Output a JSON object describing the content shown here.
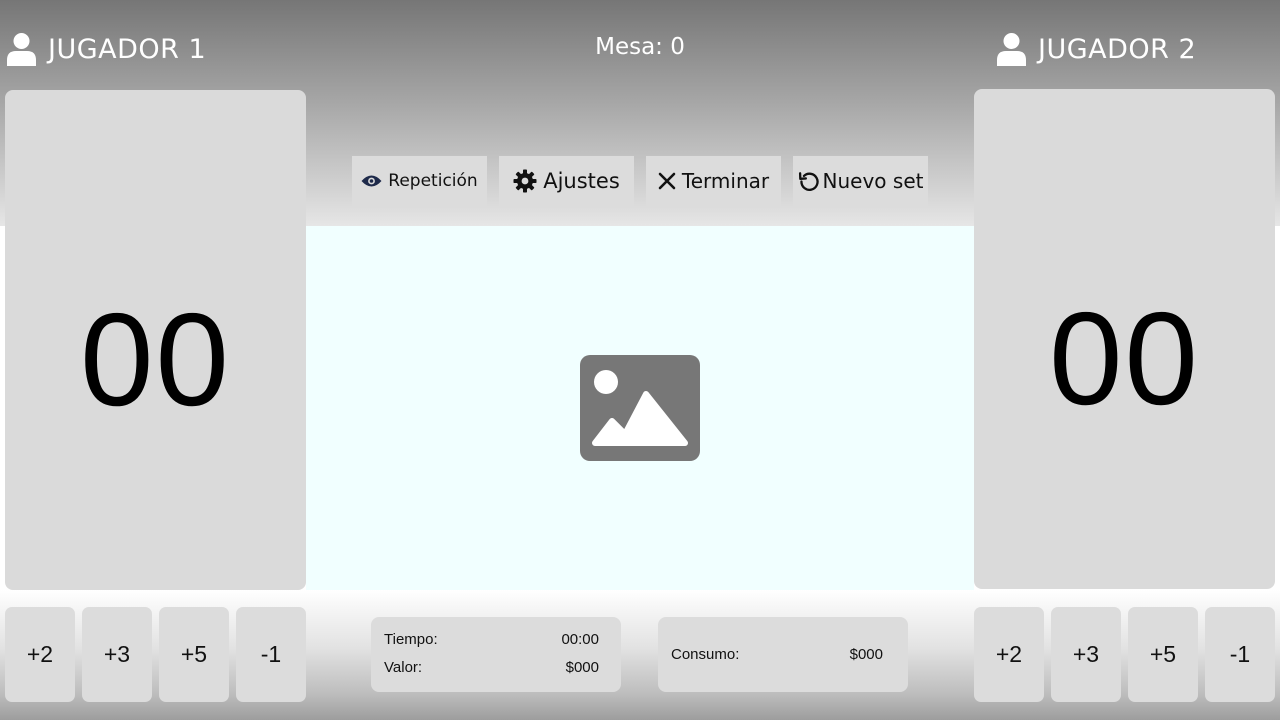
{
  "player1": {
    "name": "JUGADOR 1",
    "score": "00",
    "icon": "user-icon"
  },
  "player2": {
    "name": "JUGADOR 2",
    "score": "00",
    "icon": "user-icon"
  },
  "mesa": "Mesa: 0",
  "toolbar": {
    "repeticion_label": "Repetición",
    "ajustes_label": "Ajustes",
    "terminar_label": "Terminar",
    "nuevo_set_label": "Nuevo set"
  },
  "score_buttons": [
    "+2",
    "+3",
    "+5",
    "-1"
  ],
  "info": {
    "tiempo_label": "Tiempo:",
    "tiempo_value": "00:00",
    "valor_label": "Valor:",
    "valor_value": "$000",
    "consumo_label": "Consumo:",
    "consumo_value": "$000"
  },
  "colors": {
    "panel": "#dadada",
    "button": "#dcdcdc",
    "center_bg": "#f1ffff",
    "eye_icon": "#1e2a4a",
    "image_placeholder": "#777777"
  }
}
